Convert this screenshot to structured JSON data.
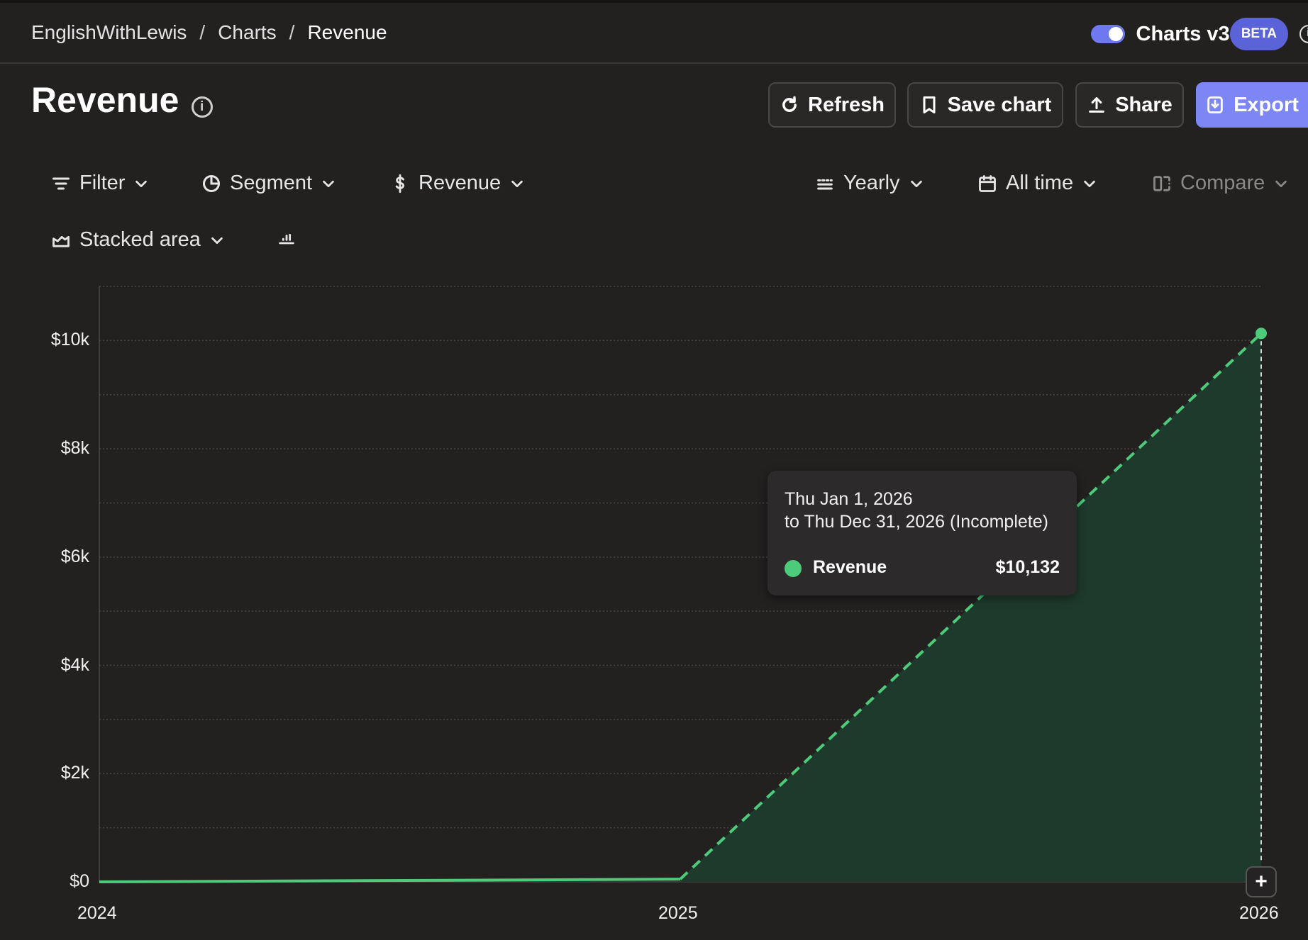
{
  "breadcrumb": {
    "items": [
      "EnglishWithLewis",
      "Charts",
      "Revenue"
    ]
  },
  "header": {
    "toggle_label": "Charts v3",
    "badge": "BETA",
    "toggle_on": true
  },
  "page": {
    "title": "Revenue"
  },
  "actions": {
    "refresh": "Refresh",
    "save": "Save chart",
    "share": "Share",
    "export": "Export"
  },
  "controls": {
    "filter": "Filter",
    "segment": "Segment",
    "metric": "Revenue",
    "interval": "Yearly",
    "range": "All time",
    "compare": "Compare",
    "chart_type": "Stacked area"
  },
  "tooltip": {
    "line1": "Thu Jan 1, 2026",
    "line2": "to Thu Dec 31, 2026 (Incomplete)",
    "series": "Revenue",
    "value": "$10,132"
  },
  "colors": {
    "accent": "#7c86f4",
    "series": "#4dcb7a",
    "fill": "#1e3a2c",
    "background": "#232020"
  },
  "chart_data": {
    "type": "area",
    "x": [
      "2024",
      "2025",
      "2026"
    ],
    "series": [
      {
        "name": "Revenue",
        "values": [
          0,
          50,
          10132
        ]
      }
    ],
    "ylim": [
      0,
      11000
    ],
    "yticks": [
      0,
      2000,
      4000,
      6000,
      8000,
      10000
    ],
    "ytick_labels": [
      "$0",
      "$2k",
      "$4k",
      "$6k",
      "$8k",
      "$10k"
    ],
    "xtick_labels": [
      "2024",
      "2025",
      "2026"
    ],
    "grid": true,
    "incomplete_last_period": true
  }
}
